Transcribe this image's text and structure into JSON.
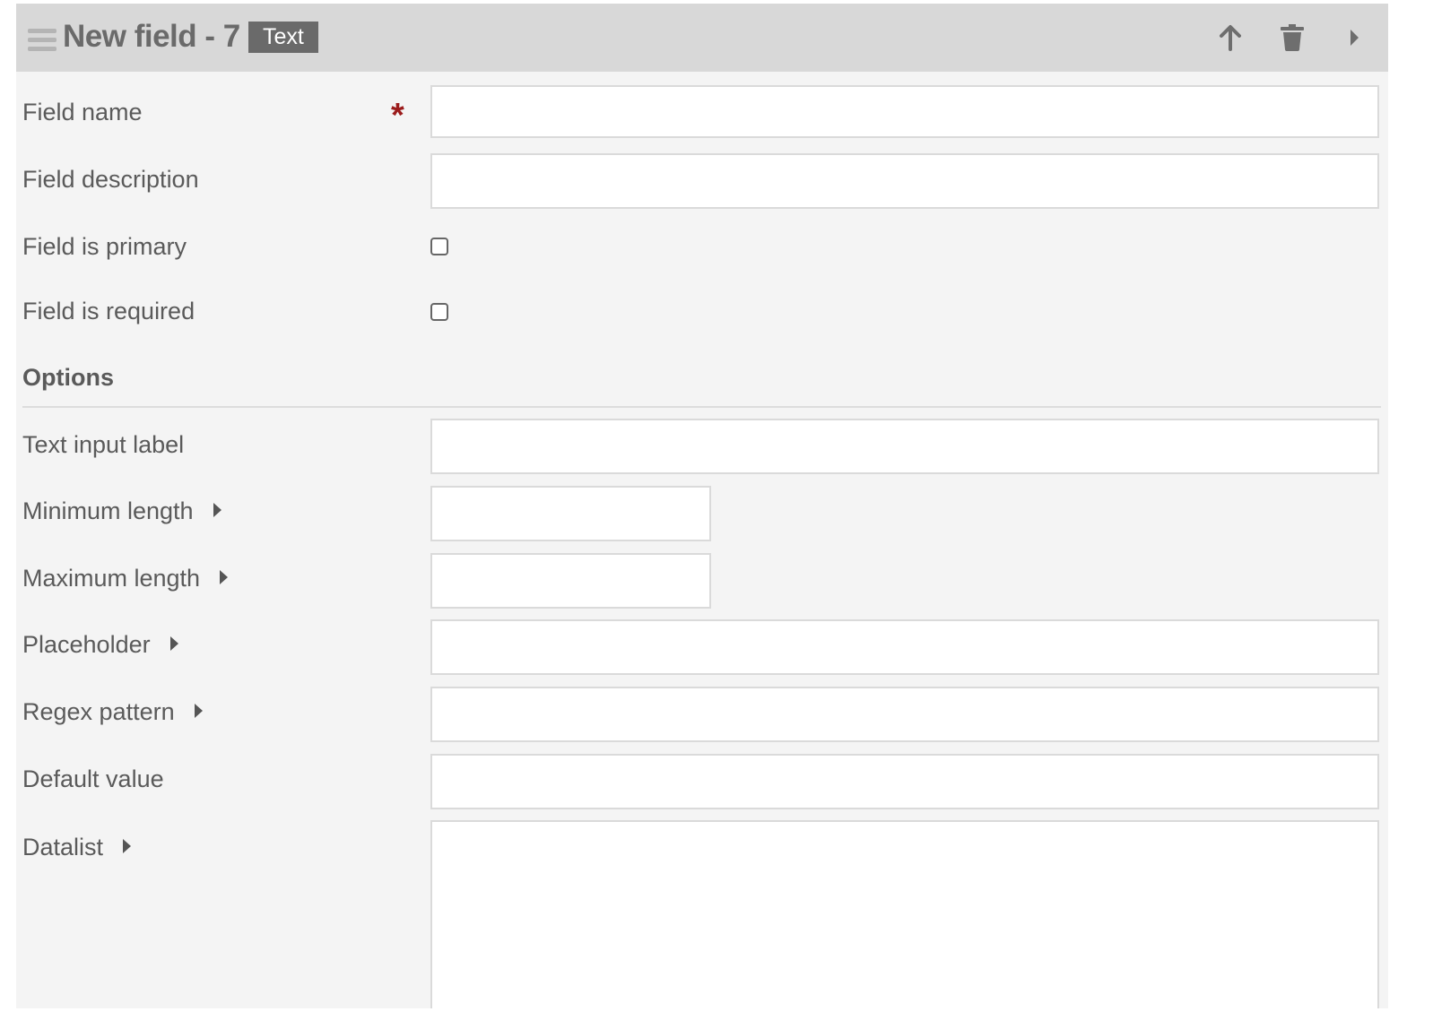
{
  "header": {
    "title": "New field - 7",
    "type_badge": "Text",
    "actions": [
      "arrow-up-icon",
      "trash-icon",
      "caret-right-icon"
    ]
  },
  "form": {
    "field_name": {
      "label": "Field name",
      "required_marker": "*",
      "value": ""
    },
    "field_description": {
      "label": "Field description",
      "value": ""
    },
    "field_is_primary": {
      "label": "Field is primary",
      "checked": false
    },
    "field_is_required": {
      "label": "Field is required",
      "checked": false
    }
  },
  "options": {
    "heading": "Options",
    "text_input_label": {
      "label": "Text input label",
      "value": ""
    },
    "minimum_length": {
      "label": "Minimum length",
      "value": ""
    },
    "maximum_length": {
      "label": "Maximum length",
      "value": ""
    },
    "placeholder": {
      "label": "Placeholder",
      "value": ""
    },
    "regex_pattern": {
      "label": "Regex pattern",
      "value": ""
    },
    "default_value": {
      "label": "Default value",
      "value": ""
    },
    "datalist": {
      "label": "Datalist",
      "value": ""
    }
  },
  "colors": {
    "header_bg": "#d8d8d8",
    "panel_bg": "#f4f4f4",
    "badge_bg": "#6a6a6a",
    "required": "#9b1c1c"
  }
}
